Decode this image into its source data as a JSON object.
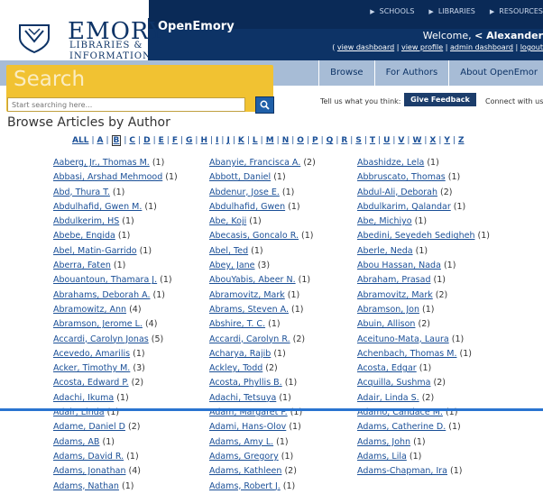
{
  "header": {
    "logo": {
      "name": "EMORY",
      "sub": "LIBRARIES & INFORMATION TECHNOLOGY"
    },
    "brand": "OpenEmory",
    "top_links": [
      "SCHOOLS",
      "LIBRARIES",
      "RESOURCES"
    ],
    "welcome_prefix": "Welcome,",
    "welcome_user": "< Alexander",
    "account_links": [
      "view dashboard",
      "view profile",
      "admin dashboard",
      "logout"
    ]
  },
  "nav": [
    "Browse",
    "For Authors",
    "About OpenEmor"
  ],
  "search": {
    "title": "Search",
    "placeholder": "Start searching here..."
  },
  "feedback": {
    "label": "Tell us what you think:",
    "button": "Give Feedback",
    "connect": "Connect with us:"
  },
  "page_title": "Browse Articles by Author",
  "alphabet": [
    "ALL",
    "A",
    "B",
    "C",
    "D",
    "E",
    "F",
    "G",
    "H",
    "I",
    "J",
    "K",
    "L",
    "M",
    "N",
    "O",
    "P",
    "Q",
    "R",
    "S",
    "T",
    "U",
    "V",
    "W",
    "X",
    "Y",
    "Z"
  ],
  "selected_letter": "B",
  "columns": [
    [
      {
        "name": "Aaberg, Jr., Thomas M.",
        "count": "(1)"
      },
      {
        "name": "Abbasi, Arshad Mehmood",
        "count": "(1)"
      },
      {
        "name": "Abd, Thura T.",
        "count": "(1)"
      },
      {
        "name": "Abdulhafid, Gwen M.",
        "count": "(1)"
      },
      {
        "name": "Abdulkerim, HS",
        "count": "(1)"
      },
      {
        "name": "Abebe, Engida",
        "count": "(1)"
      },
      {
        "name": "Abel, Matin-Garrido",
        "count": "(1)"
      },
      {
        "name": "Aberra, Faten",
        "count": "(1)"
      },
      {
        "name": "Abouantoun, Thamara J.",
        "count": "(1)"
      },
      {
        "name": "Abrahams, Deborah A.",
        "count": "(1)"
      },
      {
        "name": "Abramowitz, Ann",
        "count": "(4)"
      },
      {
        "name": "Abramson, Jerome L.",
        "count": "(4)"
      },
      {
        "name": "Accardi, Carolyn Jonas",
        "count": "(5)"
      },
      {
        "name": "Acevedo, Amarilis",
        "count": "(1)"
      },
      {
        "name": "Acker, Timothy M.",
        "count": "(3)"
      },
      {
        "name": "Acosta, Edward P.",
        "count": "(2)"
      },
      {
        "name": "Adachi, Ikuma",
        "count": "(1)"
      },
      {
        "name": "Adair, Linda",
        "count": "(1)"
      },
      {
        "name": "Adame, Daniel D",
        "count": "(2)"
      },
      {
        "name": "Adams, AB",
        "count": "(1)"
      },
      {
        "name": "Adams, David R.",
        "count": "(1)"
      },
      {
        "name": "Adams, Jonathan",
        "count": "(4)"
      },
      {
        "name": "Adams, Nathan",
        "count": "(1)"
      }
    ],
    [
      {
        "name": "Abanyie, Francisca A.",
        "count": "(2)"
      },
      {
        "name": "Abbott, Daniel",
        "count": "(1)"
      },
      {
        "name": "Abdenur, Jose E.",
        "count": "(1)"
      },
      {
        "name": "Abdulhafid, Gwen",
        "count": "(1)"
      },
      {
        "name": "Abe, Koji",
        "count": "(1)"
      },
      {
        "name": "Abecasis, Goncalo R.",
        "count": "(1)"
      },
      {
        "name": "Abel, Ted",
        "count": "(1)"
      },
      {
        "name": "Abey, Jane",
        "count": "(3)"
      },
      {
        "name": "AbouYabis, Abeer N.",
        "count": "(1)"
      },
      {
        "name": "Abramovitz, Mark",
        "count": "(1)"
      },
      {
        "name": "Abrams, Steven A.",
        "count": "(1)"
      },
      {
        "name": "Abshire, T. C.",
        "count": "(1)"
      },
      {
        "name": "Accardi, Carolyn R.",
        "count": "(2)"
      },
      {
        "name": "Acharya, Rajib",
        "count": "(1)"
      },
      {
        "name": "Ackley, Todd",
        "count": "(2)"
      },
      {
        "name": "Acosta, Phyllis B.",
        "count": "(1)"
      },
      {
        "name": "Adachi, Tetsuya",
        "count": "(1)"
      },
      {
        "name": "Adam, Margaret P.",
        "count": "(1)"
      },
      {
        "name": "Adami, Hans-Olov",
        "count": "(1)"
      },
      {
        "name": "Adams, Amy L.",
        "count": "(1)"
      },
      {
        "name": "Adams, Gregory",
        "count": "(1)"
      },
      {
        "name": "Adams, Kathleen",
        "count": "(2)"
      },
      {
        "name": "Adams, Robert J.",
        "count": "(1)"
      }
    ],
    [
      {
        "name": "Abashidze, Lela",
        "count": "(1)"
      },
      {
        "name": "Abbruscato, Thomas",
        "count": "(1)"
      },
      {
        "name": "Abdul-Ali, Deborah",
        "count": "(2)"
      },
      {
        "name": "Abdulkarim, Qalandar",
        "count": "(1)"
      },
      {
        "name": "Abe, Michiyo",
        "count": "(1)"
      },
      {
        "name": "Abedini, Seyedeh Sedigheh",
        "count": "(1)"
      },
      {
        "name": "Aberle, Neda",
        "count": "(1)"
      },
      {
        "name": "Abou Hassan, Nada",
        "count": "(1)"
      },
      {
        "name": "Abraham, Prasad",
        "count": "(1)"
      },
      {
        "name": "Abramovitz, Mark",
        "count": "(2)"
      },
      {
        "name": "Abramson, Jon",
        "count": "(1)"
      },
      {
        "name": "Abuin, Allison",
        "count": "(2)"
      },
      {
        "name": "Aceituno-Mata, Laura",
        "count": "(1)"
      },
      {
        "name": "Achenbach, Thomas M.",
        "count": "(1)"
      },
      {
        "name": "Acosta, Edgar",
        "count": "(1)"
      },
      {
        "name": "Acquilla, Sushma",
        "count": "(2)"
      },
      {
        "name": "Adair, Linda S.",
        "count": "(2)"
      },
      {
        "name": "Adamo, Candace M.",
        "count": "(1)"
      },
      {
        "name": "Adams, Catherine D.",
        "count": "(1)"
      },
      {
        "name": "Adams, John",
        "count": "(1)"
      },
      {
        "name": "Adams, Lila",
        "count": "(1)"
      },
      {
        "name": "Adams-Chapman, Ira",
        "count": "(1)"
      }
    ]
  ],
  "colors": {
    "navy": "#0d3366",
    "gold": "#f1c232",
    "nav_blue": "#a7bcd6",
    "link": "#1a4f97"
  }
}
